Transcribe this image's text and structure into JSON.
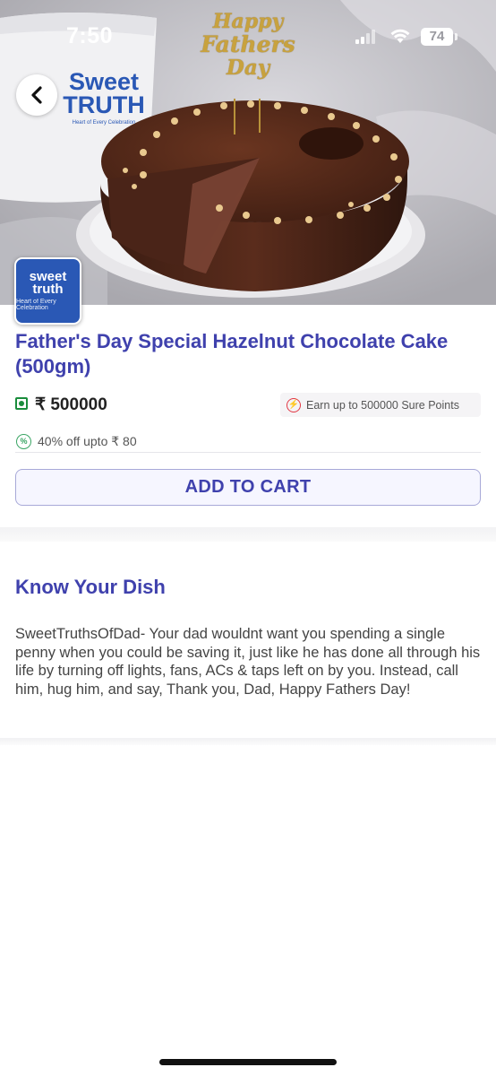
{
  "status_bar": {
    "time": "7:50",
    "battery": "74"
  },
  "hero": {
    "topper_line1": "Happy",
    "topper_line2": "Fathers",
    "topper_line3": "Day",
    "mug_brand_line1": "Sweet",
    "mug_brand_line2": "TRUTH",
    "mug_tagline": "Heart of Every Celebration"
  },
  "store": {
    "logo_line1": "sweet",
    "logo_line2": "truth",
    "logo_tagline": "Heart of Every Celebration"
  },
  "product": {
    "title": "Father's Day Special Hazelnut Chocolate Cake (500gm)",
    "price": "₹ 500000",
    "points_text": "Earn up to 500000 Sure Points",
    "offer_text": "40% off upto ₹ 80",
    "add_to_cart_label": "ADD TO CART"
  },
  "dish": {
    "heading": "Know Your Dish",
    "description": "SweetTruthsOfDad- Your dad wouldnt want you spending a single penny when you could be saving it, just like he has done all through his life by turning off lights, fans, ACs & taps left on by you. Instead, call him, hug him, and say, Thank you, Dad, Happy Fathers Day!"
  },
  "colors": {
    "accent": "#3f41ad",
    "veg": "#1a8d3c",
    "points_icon": "#e23744",
    "offer_icon": "#3aa564"
  }
}
